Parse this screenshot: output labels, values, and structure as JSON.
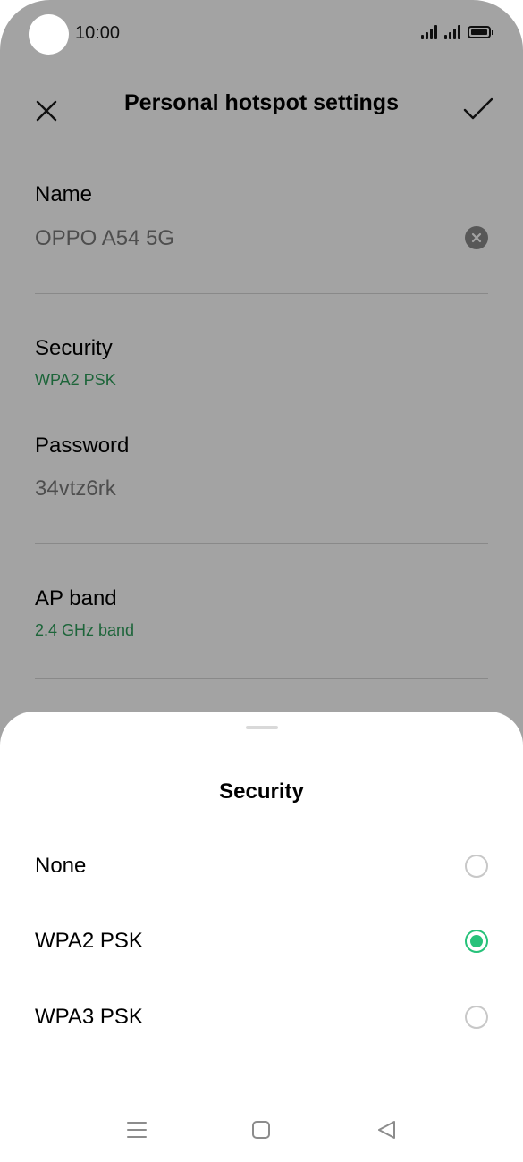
{
  "status_bar": {
    "time": "10:00"
  },
  "header": {
    "title": "Personal hotspot settings",
    "close_icon": "close-icon",
    "confirm_icon": "checkmark-icon"
  },
  "fields": {
    "name": {
      "label": "Name",
      "value": "OPPO A54 5G",
      "clear_icon": "clear-icon"
    },
    "security": {
      "label": "Security",
      "value": "WPA2 PSK"
    },
    "password": {
      "label": "Password",
      "value": "34vtz6rk"
    },
    "ap_band": {
      "label": "AP band",
      "value": "2.4 GHz band"
    }
  },
  "sheet": {
    "title": "Security",
    "options": [
      {
        "label": "None",
        "selected": false
      },
      {
        "label": "WPA2 PSK",
        "selected": true
      },
      {
        "label": "WPA3 PSK",
        "selected": false
      }
    ]
  },
  "colors": {
    "accent_green": "#27c27a",
    "subtitle_green": "#2e9e5b"
  },
  "nav": {
    "icons": [
      "menu-icon",
      "home-icon",
      "back-icon"
    ]
  }
}
